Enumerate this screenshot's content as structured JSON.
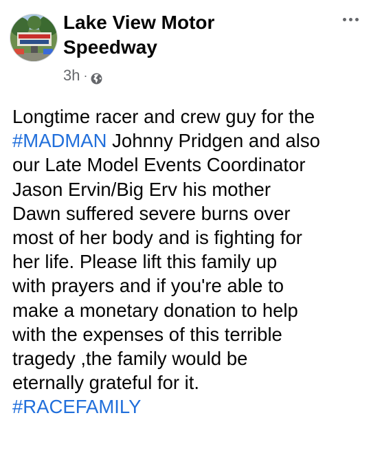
{
  "post": {
    "author": {
      "name_line1": "Lake View Motor",
      "name_line2": "Speedway"
    },
    "timestamp": "3h",
    "separator": "·",
    "audience_icon": "globe-icon",
    "menu_icon": "more-options-icon",
    "hashtag_color": "#216fdb",
    "body": {
      "line1": "Longtime racer and crew guy for the",
      "line2_hashtag": "#MADMAN",
      "line2_rest": " Johnny Pridgen and also",
      "line3": "our Late Model Events Coordinator",
      "line4": "Jason Ervin/Big Erv his mother",
      "line5": "Dawn suffered severe burns over",
      "line6": "most of her body and is fighting for",
      "line7": "her life. Please lift this family up",
      "line8": "with prayers and if you're able to",
      "line9": "make a monetary donation to help",
      "line10": "with the expenses of this terrible",
      "line11": "tragedy ,the family would be",
      "line12": "eternally grateful for it.",
      "line13_hashtag": "#RACEFAMILY"
    }
  }
}
